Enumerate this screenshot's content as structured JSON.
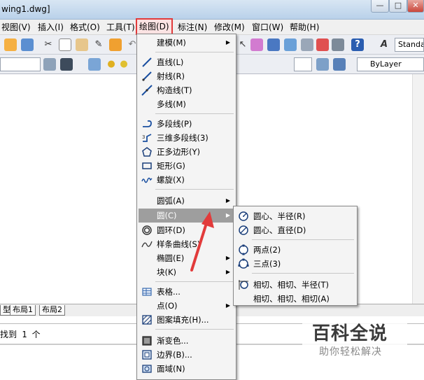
{
  "window": {
    "title": "wing1.dwg]",
    "minimize_glyph": "—",
    "maximize_glyph": "□",
    "close_glyph": "✕"
  },
  "menubar": {
    "items": [
      "视图(V)",
      "插入(I)",
      "格式(O)",
      "工具(T)",
      "绘图(D)",
      "标注(N)",
      "修改(M)",
      "窗口(W)",
      "帮助(H)"
    ]
  },
  "toolbar": {
    "style_combo": "Standar",
    "layer_combo": "ByLayer"
  },
  "layout_tabs": [
    "型",
    "布局1",
    "布局2"
  ],
  "command_line": {
    "text": "找到 1 个"
  },
  "draw_menu": {
    "items": [
      {
        "label": "建模(M)",
        "icon": "none",
        "has_submenu": true
      },
      {
        "label": "直线(L)",
        "icon": "line-icon"
      },
      {
        "label": "射线(R)",
        "icon": "ray-icon"
      },
      {
        "label": "构造线(T)",
        "icon": "construction-line-icon"
      },
      {
        "label": "多线(M)",
        "icon": "none"
      },
      {
        "label": "多段线(P)",
        "icon": "polyline-icon"
      },
      {
        "label": "三维多段线(3)",
        "icon": "3d-polyline-icon"
      },
      {
        "label": "正多边形(Y)",
        "icon": "polygon-icon"
      },
      {
        "label": "矩形(G)",
        "icon": "rectangle-icon"
      },
      {
        "label": "螺旋(X)",
        "icon": "helix-icon"
      },
      {
        "label": "圆弧(A)",
        "icon": "none",
        "has_submenu": true
      },
      {
        "label": "圆(C)",
        "icon": "none",
        "has_submenu": true,
        "highlighted": true
      },
      {
        "label": "圆环(D)",
        "icon": "donut-icon"
      },
      {
        "label": "样条曲线(S)",
        "icon": "spline-icon"
      },
      {
        "label": "椭圆(E)",
        "icon": "none",
        "has_submenu": true
      },
      {
        "label": "块(K)",
        "icon": "none",
        "has_submenu": true
      },
      {
        "label": "表格...",
        "icon": "table-icon"
      },
      {
        "label": "点(O)",
        "icon": "none",
        "has_submenu": true
      },
      {
        "label": "图案填充(H)...",
        "icon": "hatch-icon"
      },
      {
        "label": "渐变色...",
        "icon": "gradient-icon"
      },
      {
        "label": "边界(B)...",
        "icon": "boundary-icon"
      },
      {
        "label": "面域(N)",
        "icon": "region-icon"
      }
    ]
  },
  "circle_submenu": {
    "items": [
      {
        "label": "圆心、半径(R)",
        "icon": "circle-center-radius-icon"
      },
      {
        "label": "圆心、直径(D)",
        "icon": "circle-center-diameter-icon"
      },
      {
        "label": "两点(2)",
        "icon": "circle-2point-icon"
      },
      {
        "label": "三点(3)",
        "icon": "circle-3point-icon"
      },
      {
        "label": "相切、相切、半径(T)",
        "icon": "circle-ttr-icon"
      },
      {
        "label": "相切、相切、相切(A)",
        "icon": "none"
      }
    ]
  },
  "watermark": {
    "title": "百科全说",
    "subtitle": "助你轻松解决"
  },
  "colors": {
    "highlight": "#9e9e9e",
    "callout_red": "#e23b3b"
  }
}
